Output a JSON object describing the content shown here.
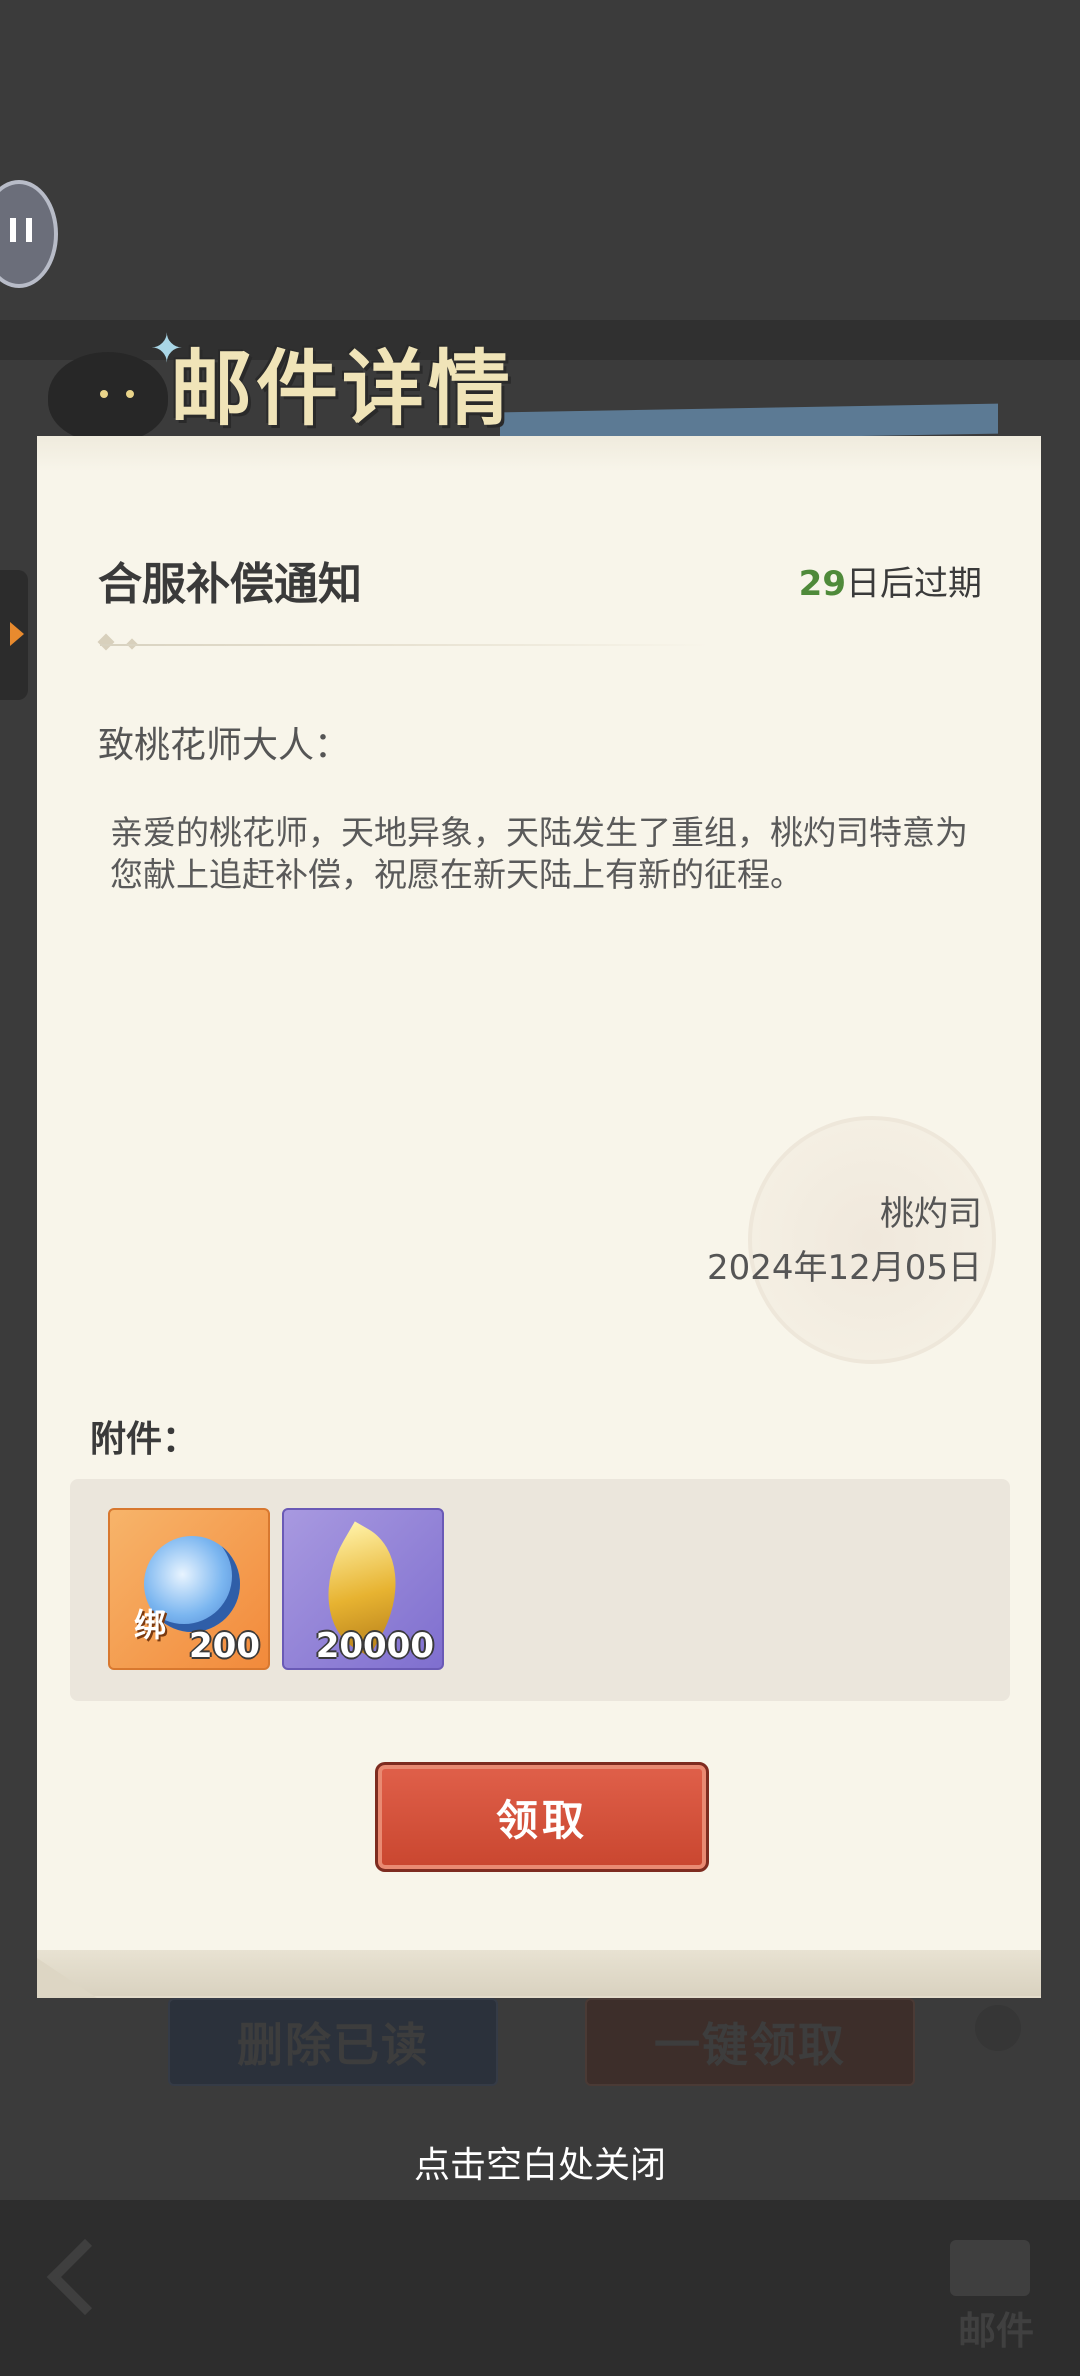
{
  "page": {
    "close_hint": "点击空白处关闭"
  },
  "header": {
    "title": "邮件详情"
  },
  "mail": {
    "subject": "合服补偿通知",
    "expiry_days": "29",
    "expiry_suffix": "日后过期",
    "greeting": "致桃花师大人：",
    "body": "亲爱的桃花师，天地异象，天陆发生了重组，桃灼司特意为您献上追赶补偿，祝愿在新天陆上有新的征程。",
    "signature": "桃灼司",
    "date": "2024年12月05日"
  },
  "attachments": {
    "label": "附件：",
    "items": [
      {
        "name": "blue-gem",
        "tag": "绑",
        "quantity": "200"
      },
      {
        "name": "gold-leaf",
        "quantity": "20000"
      }
    ]
  },
  "actions": {
    "claim_label": "领取"
  },
  "background": {
    "delete_read_label": "删除已读",
    "claim_all_label": "一键领取",
    "mail_tab_label": "邮件"
  },
  "colors": {
    "expiry_accent": "#4f8a3a",
    "claim_button": "#d6533c",
    "paper": "#f8f5ea"
  }
}
